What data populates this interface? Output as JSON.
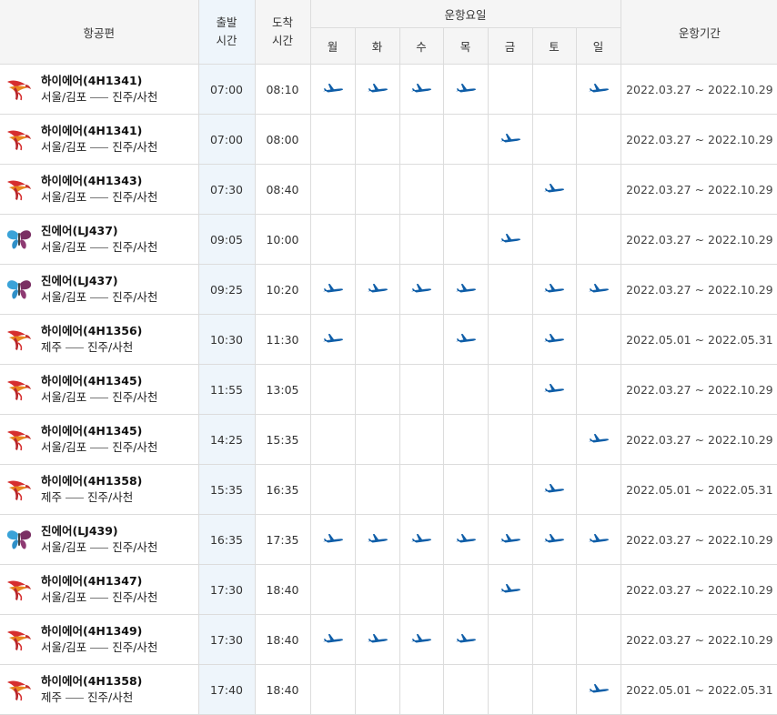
{
  "headers": {
    "flight": "항공편",
    "departure": "출발\n시간",
    "arrival": "도착\n시간",
    "days_group": "운항요일",
    "period": "운항기간",
    "days": [
      "월",
      "화",
      "수",
      "목",
      "금",
      "토",
      "일"
    ]
  },
  "colors": {
    "plane": "#0f5ea8",
    "header_bg": "#f5f5f5",
    "departure_bg": "#eef5fb",
    "border": "#dcdcdc"
  },
  "rows": [
    {
      "airline": "hi-air",
      "flight": "하이에어(4H1341)",
      "from": "서울/김포",
      "to": "진주/사천",
      "dep": "07:00",
      "arr": "08:10",
      "days": [
        1,
        1,
        1,
        1,
        0,
        0,
        1
      ],
      "period": "2022.03.27 ~ 2022.10.29"
    },
    {
      "airline": "hi-air",
      "flight": "하이에어(4H1341)",
      "from": "서울/김포",
      "to": "진주/사천",
      "dep": "07:00",
      "arr": "08:00",
      "days": [
        0,
        0,
        0,
        0,
        1,
        0,
        0
      ],
      "period": "2022.03.27 ~ 2022.10.29"
    },
    {
      "airline": "hi-air",
      "flight": "하이에어(4H1343)",
      "from": "서울/김포",
      "to": "진주/사천",
      "dep": "07:30",
      "arr": "08:40",
      "days": [
        0,
        0,
        0,
        0,
        0,
        1,
        0
      ],
      "period": "2022.03.27 ~ 2022.10.29"
    },
    {
      "airline": "jin-air",
      "flight": "진에어(LJ437)",
      "from": "서울/김포",
      "to": "진주/사천",
      "dep": "09:05",
      "arr": "10:00",
      "days": [
        0,
        0,
        0,
        0,
        1,
        0,
        0
      ],
      "period": "2022.03.27 ~ 2022.10.29"
    },
    {
      "airline": "jin-air",
      "flight": "진에어(LJ437)",
      "from": "서울/김포",
      "to": "진주/사천",
      "dep": "09:25",
      "arr": "10:20",
      "days": [
        1,
        1,
        1,
        1,
        0,
        1,
        1
      ],
      "period": "2022.03.27 ~ 2022.10.29"
    },
    {
      "airline": "hi-air",
      "flight": "하이에어(4H1356)",
      "from": "제주",
      "to": "진주/사천",
      "dep": "10:30",
      "arr": "11:30",
      "days": [
        1,
        0,
        0,
        1,
        0,
        1,
        0
      ],
      "period": "2022.05.01 ~ 2022.05.31"
    },
    {
      "airline": "hi-air",
      "flight": "하이에어(4H1345)",
      "from": "서울/김포",
      "to": "진주/사천",
      "dep": "11:55",
      "arr": "13:05",
      "days": [
        0,
        0,
        0,
        0,
        0,
        1,
        0
      ],
      "period": "2022.03.27 ~ 2022.10.29"
    },
    {
      "airline": "hi-air",
      "flight": "하이에어(4H1345)",
      "from": "서울/김포",
      "to": "진주/사천",
      "dep": "14:25",
      "arr": "15:35",
      "days": [
        0,
        0,
        0,
        0,
        0,
        0,
        1
      ],
      "period": "2022.03.27 ~ 2022.10.29"
    },
    {
      "airline": "hi-air",
      "flight": "하이에어(4H1358)",
      "from": "제주",
      "to": "진주/사천",
      "dep": "15:35",
      "arr": "16:35",
      "days": [
        0,
        0,
        0,
        0,
        0,
        1,
        0
      ],
      "period": "2022.05.01 ~ 2022.05.31"
    },
    {
      "airline": "jin-air",
      "flight": "진에어(LJ439)",
      "from": "서울/김포",
      "to": "진주/사천",
      "dep": "16:35",
      "arr": "17:35",
      "days": [
        1,
        1,
        1,
        1,
        1,
        1,
        1
      ],
      "period": "2022.03.27 ~ 2022.10.29"
    },
    {
      "airline": "hi-air",
      "flight": "하이에어(4H1347)",
      "from": "서울/김포",
      "to": "진주/사천",
      "dep": "17:30",
      "arr": "18:40",
      "days": [
        0,
        0,
        0,
        0,
        1,
        0,
        0
      ],
      "period": "2022.03.27 ~ 2022.10.29"
    },
    {
      "airline": "hi-air",
      "flight": "하이에어(4H1349)",
      "from": "서울/김포",
      "to": "진주/사천",
      "dep": "17:30",
      "arr": "18:40",
      "days": [
        1,
        1,
        1,
        1,
        0,
        0,
        0
      ],
      "period": "2022.03.27 ~ 2022.10.29"
    },
    {
      "airline": "hi-air",
      "flight": "하이에어(4H1358)",
      "from": "제주",
      "to": "진주/사천",
      "dep": "17:40",
      "arr": "18:40",
      "days": [
        0,
        0,
        0,
        0,
        0,
        0,
        1
      ],
      "period": "2022.05.01 ~ 2022.05.31"
    }
  ]
}
